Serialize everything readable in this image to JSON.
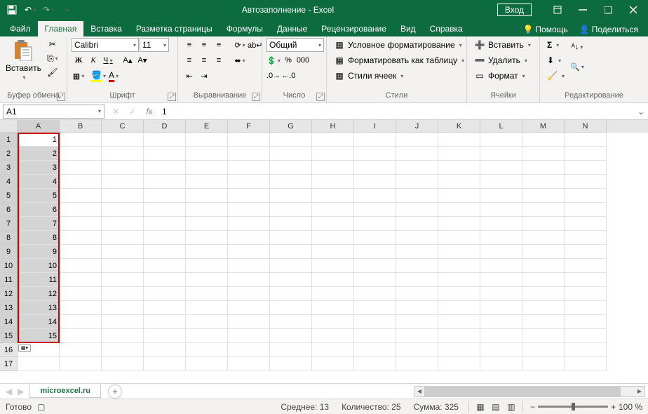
{
  "title": "Автозаполнение  -  Excel",
  "login": "Вход",
  "tabs": {
    "file": "Файл",
    "home": "Главная",
    "insert": "Вставка",
    "layout": "Разметка страницы",
    "formulas": "Формулы",
    "data": "Данные",
    "review": "Рецензирование",
    "view": "Вид",
    "help": "Справка",
    "tell": "Помощь",
    "share": "Поделиться"
  },
  "ribbon": {
    "clipboard": {
      "label": "Буфер обмена",
      "paste": "Вставить"
    },
    "font": {
      "label": "Шрифт",
      "name": "Calibri",
      "size": "11"
    },
    "align": {
      "label": "Выравнивание"
    },
    "number": {
      "label": "Число",
      "format": "Общий"
    },
    "styles": {
      "label": "Стили",
      "cond": "Условное форматирование",
      "table": "Форматировать как таблицу",
      "cell": "Стили ячеек"
    },
    "cells": {
      "label": "Ячейки",
      "insert": "Вставить",
      "delete": "Удалить",
      "format": "Формат"
    },
    "editing": {
      "label": "Редактирование"
    }
  },
  "namebox": "A1",
  "formula": "1",
  "cols": [
    "A",
    "B",
    "C",
    "D",
    "E",
    "F",
    "G",
    "H",
    "I",
    "J",
    "K",
    "L",
    "M",
    "N"
  ],
  "data_rows": [
    1,
    2,
    3,
    4,
    5,
    6,
    7,
    8,
    9,
    10,
    11,
    12,
    13,
    14,
    15
  ],
  "sheet_tab": "microexcel.ru",
  "status": {
    "ready": "Готово",
    "avg": "Среднее: 13",
    "count": "Количество: 25",
    "sum": "Сумма: 325",
    "zoom": "100 %"
  }
}
